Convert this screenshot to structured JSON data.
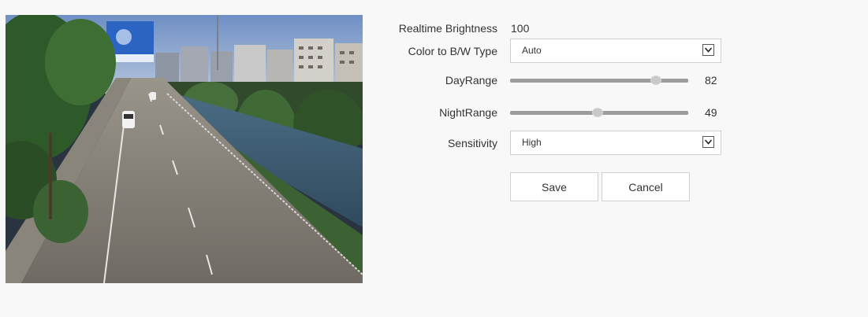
{
  "brightness": {
    "label": "Realtime Brightness",
    "value": "100"
  },
  "color_bw": {
    "label": "Color to B/W Type",
    "selected": "Auto"
  },
  "day_range": {
    "label": "DayRange",
    "value": 82
  },
  "night_range": {
    "label": "NightRange",
    "value": 49
  },
  "sensitivity": {
    "label": "Sensitivity",
    "selected": "High"
  },
  "buttons": {
    "save": "Save",
    "cancel": "Cancel"
  }
}
